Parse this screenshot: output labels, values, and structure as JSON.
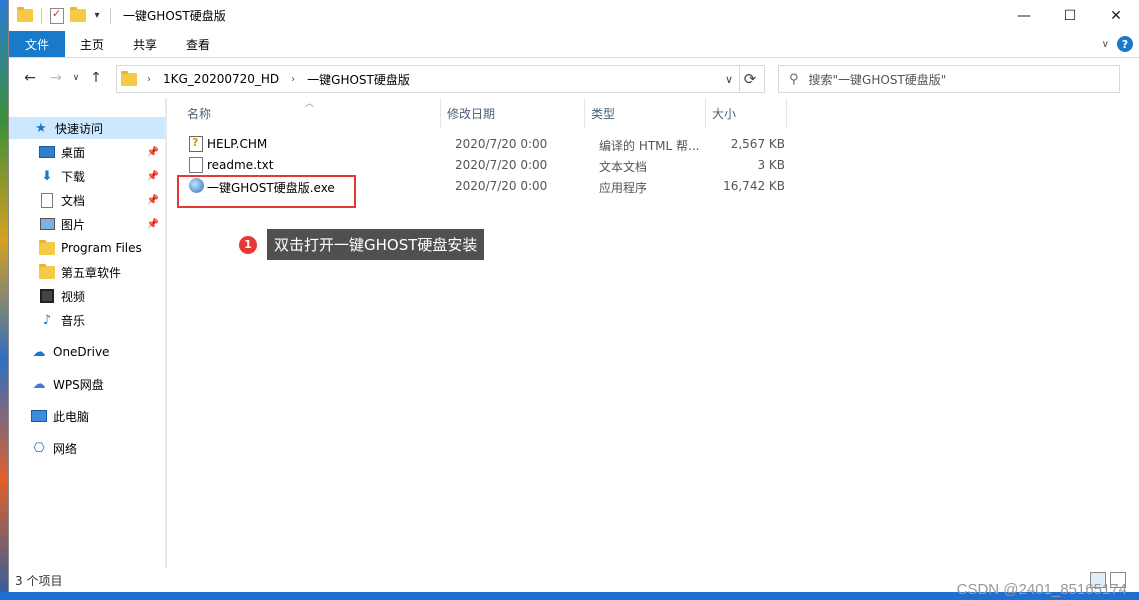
{
  "window": {
    "title": "一键GHOST硬盘版",
    "controls": {
      "minimize": "—",
      "maximize": "☐",
      "close": "✕"
    }
  },
  "ribbon": {
    "tabs": [
      "文件",
      "主页",
      "共享",
      "查看"
    ],
    "accent": "#1979ca"
  },
  "address": {
    "crumbs": [
      "1KG_20200720_HD",
      "一键GHOST硬盘版"
    ],
    "search_placeholder": "搜索\"一键GHOST硬盘版\""
  },
  "sidebar": {
    "items": [
      {
        "label": "快速访问",
        "icon": "star-icon"
      },
      {
        "label": "桌面",
        "icon": "desktop-icon",
        "pinned": true
      },
      {
        "label": "下载",
        "icon": "download-icon",
        "pinned": true
      },
      {
        "label": "文档",
        "icon": "document-icon",
        "pinned": true
      },
      {
        "label": "图片",
        "icon": "picture-icon",
        "pinned": true
      },
      {
        "label": "Program Files",
        "icon": "folder-icon"
      },
      {
        "label": "第五章软件",
        "icon": "folder-icon"
      },
      {
        "label": "视频",
        "icon": "video-icon"
      },
      {
        "label": "音乐",
        "icon": "music-icon"
      },
      {
        "label": "OneDrive",
        "icon": "cloud-icon"
      },
      {
        "label": "WPS网盘",
        "icon": "wps-cloud-icon"
      },
      {
        "label": "此电脑",
        "icon": "computer-icon"
      },
      {
        "label": "网络",
        "icon": "network-icon"
      }
    ]
  },
  "columns": [
    "名称",
    "修改日期",
    "类型",
    "大小"
  ],
  "files": [
    {
      "name": "HELP.CHM",
      "date": "2020/7/20 0:00",
      "type": "编译的 HTML 帮...",
      "size": "2,567 KB",
      "icon": "chm-file-icon"
    },
    {
      "name": "readme.txt",
      "date": "2020/7/20 0:00",
      "type": "文本文档",
      "size": "3 KB",
      "icon": "text-file-icon"
    },
    {
      "name": "一键GHOST硬盘版.exe",
      "date": "2020/7/20 0:00",
      "type": "应用程序",
      "size": "16,742 KB",
      "icon": "exe-file-icon"
    }
  ],
  "annotation": {
    "step": "1",
    "text": "双击打开一键GHOST硬盘安装",
    "highlight_color": "#e53935"
  },
  "status": {
    "count": "3 个项目"
  },
  "watermark": "CSDN @2401_85165174"
}
